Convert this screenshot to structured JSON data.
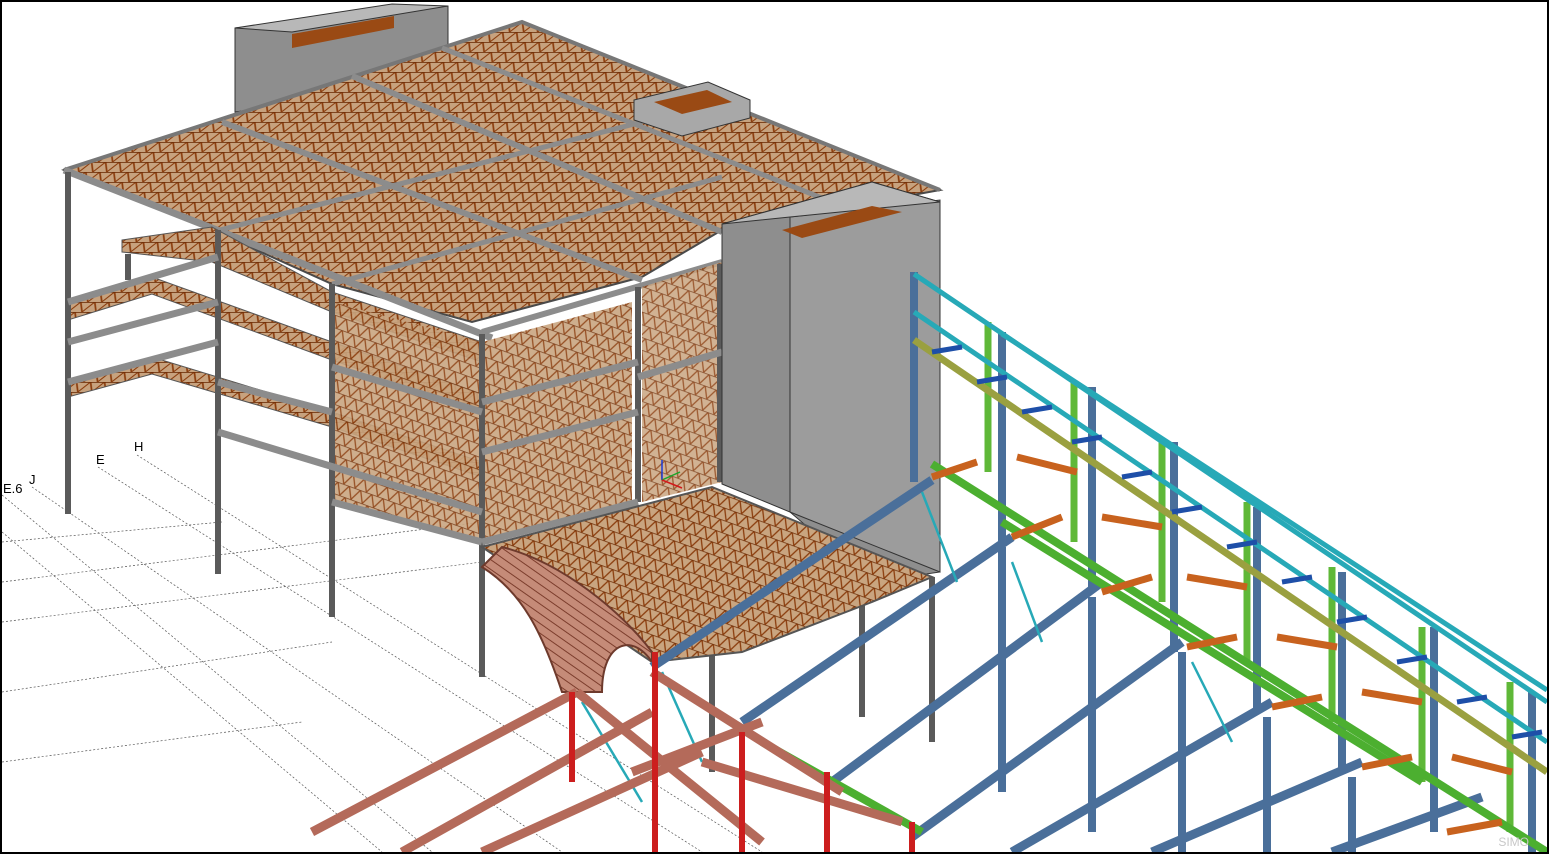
{
  "viewport": {
    "watermark": "SIMO"
  },
  "grid_labels": [
    {
      "id": "e6",
      "text": "E.6"
    },
    {
      "id": "j",
      "text": "J"
    },
    {
      "id": "e",
      "text": "E"
    },
    {
      "id": "h",
      "text": "H"
    }
  ],
  "colors": {
    "steel_grey": "#8c8c8c",
    "steel_dark": "#555555",
    "deck_brown": "#9a4a14",
    "joist_brown": "#b5652a",
    "shaft_grey": "#8e8e8e",
    "column_blue": "#4a6f9a",
    "brace_cyan": "#27a9b7",
    "beam_green": "#4caf30",
    "stringer_salmon": "#b46a5a",
    "column_red": "#cc1e1e",
    "girt_olive": "#9aa040",
    "joist_orange": "#c8621e"
  }
}
